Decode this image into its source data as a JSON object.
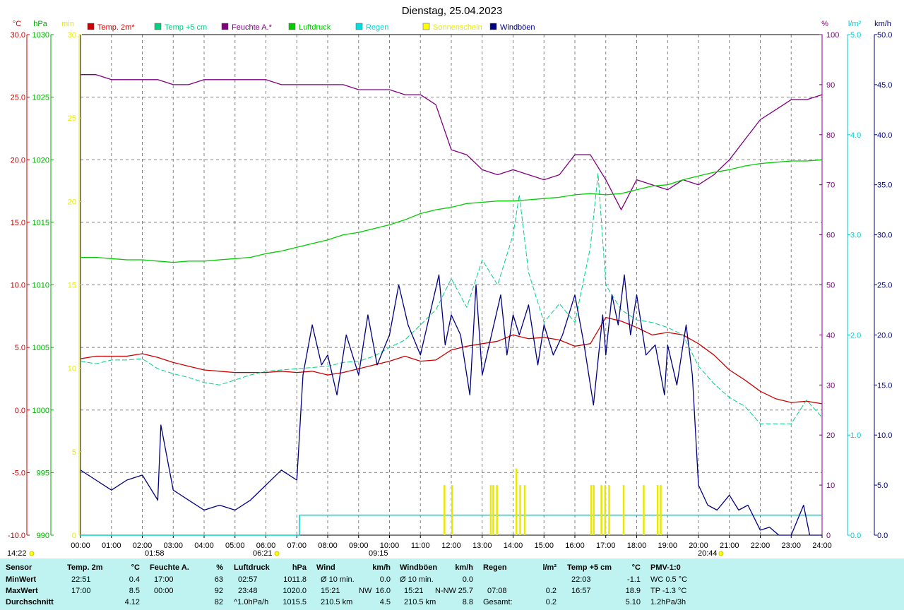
{
  "title": "Dienstag, 25.04.2023",
  "legend": [
    {
      "label": "Temp. 2m*",
      "color": "#cc0000"
    },
    {
      "label": "Temp +5 cm",
      "color": "#00d080"
    },
    {
      "label": "Feuchte A.*",
      "color": "#800080"
    },
    {
      "label": "Luftdruck",
      "color": "#00cc00"
    },
    {
      "label": "Regen",
      "color": "#00e0e0"
    },
    {
      "label": "Sonnenschein",
      "color": "#ffff00"
    },
    {
      "label": "Windböen",
      "color": "#000080"
    }
  ],
  "axis_units": {
    "temp": "°C",
    "pressure": "hPa",
    "sun": "min",
    "humidity": "%",
    "rain": "l/m²",
    "wind": "km/h"
  },
  "colors": {
    "temp": "#cc0000",
    "pressure": "#00aa00",
    "sun": "#e8e800",
    "humidity": "#800080",
    "rain": "#00d0d0",
    "wind": "#000080",
    "grid": "#808080",
    "summary_bg": "#bff3f1"
  },
  "sun_events": {
    "sunrise_label": "06:21",
    "sunset_label": "20:44",
    "moonrise_label": "01:58",
    "moonset_label": "09:15",
    "time_label": "14:22"
  },
  "chart_data": {
    "type": "line",
    "x_unit": "hour of day",
    "xlim": [
      0,
      24
    ],
    "x_ticks": [
      "00:00",
      "01:00",
      "02:00",
      "03:00",
      "04:00",
      "05:00",
      "06:00",
      "07:00",
      "08:00",
      "09:00",
      "10:00",
      "11:00",
      "12:00",
      "13:00",
      "14:00",
      "15:00",
      "16:00",
      "17:00",
      "18:00",
      "19:00",
      "20:00",
      "21:00",
      "22:00",
      "23:00",
      "24:00"
    ],
    "axes": {
      "temp": {
        "range": [
          -10,
          30
        ],
        "ticks": [
          "30.0",
          "25.0",
          "20.0",
          "15.0",
          "10.0",
          "5.0",
          "0.0",
          "-5.0",
          "-10.0"
        ]
      },
      "pressure": {
        "range": [
          990,
          1030
        ],
        "ticks": [
          "1030",
          "1025",
          "1020",
          "1015",
          "1010",
          "1005",
          "1000",
          "995",
          "990"
        ]
      },
      "sun": {
        "range": [
          0,
          30
        ],
        "ticks": [
          "30",
          "25",
          "20",
          "15",
          "10",
          "5",
          "0"
        ]
      },
      "humidity": {
        "range": [
          0,
          100
        ],
        "ticks": [
          "100",
          "90",
          "80",
          "70",
          "60",
          "50",
          "40",
          "30",
          "20",
          "10",
          "0"
        ]
      },
      "rain": {
        "range": [
          0,
          5
        ],
        "ticks": [
          "5.0",
          "4.0",
          "3.0",
          "2.0",
          "1.0",
          "0.0"
        ]
      },
      "wind": {
        "range": [
          0,
          50
        ],
        "ticks": [
          "50.0",
          "45.0",
          "40.0",
          "35.0",
          "30.0",
          "25.0",
          "20.0",
          "15.0",
          "10.0",
          "5.0",
          "0.0"
        ]
      }
    },
    "series": [
      {
        "name": "Temp. 2m*",
        "axis": "temp",
        "x": [
          0,
          0.5,
          1,
          1.5,
          2,
          2.5,
          3,
          3.5,
          4,
          4.5,
          5,
          5.5,
          6,
          6.5,
          7,
          7.5,
          8,
          8.5,
          9,
          9.5,
          10,
          10.5,
          11,
          11.5,
          12,
          12.5,
          13,
          13.5,
          14,
          14.5,
          15,
          15.5,
          16,
          16.5,
          17,
          17.5,
          18,
          18.5,
          19,
          19.5,
          20,
          20.5,
          21,
          21.5,
          22,
          22.5,
          23,
          23.5,
          24
        ],
        "y": [
          4.1,
          4.3,
          4.3,
          4.3,
          4.5,
          4.2,
          3.8,
          3.5,
          3.2,
          3.1,
          3.0,
          3.0,
          3.0,
          3.1,
          3.0,
          3.1,
          2.8,
          3.0,
          3.3,
          3.6,
          3.9,
          4.3,
          3.9,
          4.0,
          4.8,
          5.1,
          5.3,
          5.5,
          6.0,
          5.7,
          5.8,
          5.6,
          5.1,
          5.3,
          7.4,
          7.1,
          6.6,
          6.0,
          6.2,
          6.0,
          5.3,
          4.4,
          3.2,
          2.4,
          1.5,
          0.9,
          0.6,
          0.7,
          0.5
        ]
      },
      {
        "name": "Temp +5 cm",
        "axis": "temp",
        "x": [
          0,
          0.5,
          1,
          1.5,
          2,
          2.5,
          3,
          3.5,
          4,
          4.5,
          5,
          5.5,
          6,
          6.5,
          7,
          7.5,
          8,
          8.5,
          9,
          9.5,
          10,
          10.5,
          11,
          11.5,
          12,
          12.5,
          13,
          13.5,
          14,
          14.2,
          14.5,
          15,
          15.5,
          16,
          16.5,
          16.75,
          17,
          17.5,
          18,
          18.5,
          19,
          19.5,
          20,
          20.5,
          21,
          21.5,
          22,
          22.5,
          23,
          23.5,
          24
        ],
        "y": [
          3.9,
          3.7,
          4.0,
          4.0,
          4.1,
          3.3,
          2.9,
          2.6,
          2.2,
          2.0,
          2.4,
          2.8,
          3.1,
          3.2,
          3.3,
          3.4,
          3.5,
          3.8,
          3.9,
          4.3,
          5.0,
          5.6,
          6.8,
          8.0,
          10.5,
          8.2,
          12.0,
          10.0,
          14.0,
          17.2,
          11.0,
          7.0,
          8.5,
          7.0,
          13.0,
          18.9,
          10.0,
          8.0,
          7.2,
          7.0,
          6.6,
          6.0,
          3.5,
          2.1,
          1.0,
          0.3,
          -1.1,
          -1.1,
          -1.1,
          0.8,
          -0.6
        ]
      },
      {
        "name": "Feuchte A.*",
        "axis": "humidity",
        "x": [
          0,
          0.5,
          1,
          1.5,
          2,
          2.5,
          3,
          3.5,
          4,
          4.5,
          5,
          5.5,
          6,
          6.5,
          7,
          7.5,
          8,
          8.5,
          9,
          9.5,
          10,
          10.5,
          11,
          11.5,
          12,
          12.5,
          13,
          13.5,
          14,
          14.5,
          15,
          15.5,
          16,
          16.5,
          17,
          17.5,
          18,
          18.5,
          19,
          19.5,
          20,
          20.5,
          21,
          21.5,
          22,
          22.5,
          23,
          23.5,
          24
        ],
        "y": [
          92,
          92,
          91,
          91,
          91,
          91,
          90,
          90,
          91,
          91,
          91,
          91,
          91,
          90,
          90,
          90,
          90,
          90,
          89,
          89,
          89,
          88,
          88,
          86,
          77,
          76,
          73,
          72,
          73,
          72,
          71,
          72,
          76,
          76,
          71,
          65,
          71,
          70,
          69,
          71,
          70,
          72,
          75,
          79,
          83,
          85,
          87,
          87,
          88
        ]
      },
      {
        "name": "Luftdruck",
        "axis": "pressure",
        "x": [
          0,
          0.5,
          1,
          1.5,
          2,
          2.5,
          3,
          3.5,
          4,
          4.5,
          5,
          5.5,
          6,
          6.5,
          7,
          7.5,
          8,
          8.5,
          9,
          9.5,
          10,
          10.5,
          11,
          11.5,
          12,
          12.5,
          13,
          13.5,
          14,
          14.5,
          15,
          15.5,
          16,
          16.5,
          17,
          17.5,
          18,
          18.5,
          19,
          19.5,
          20,
          20.5,
          21,
          21.5,
          22,
          22.5,
          23,
          23.5,
          24
        ],
        "y": [
          1012.2,
          1012.2,
          1012.1,
          1012.0,
          1012.0,
          1011.9,
          1011.8,
          1011.9,
          1011.9,
          1012.0,
          1012.1,
          1012.2,
          1012.5,
          1012.7,
          1013.0,
          1013.3,
          1013.6,
          1014.0,
          1014.2,
          1014.5,
          1014.8,
          1015.2,
          1015.7,
          1016.0,
          1016.2,
          1016.5,
          1016.6,
          1016.7,
          1016.7,
          1016.8,
          1016.9,
          1017.0,
          1017.2,
          1017.3,
          1017.2,
          1017.3,
          1017.6,
          1017.9,
          1018.0,
          1018.4,
          1018.7,
          1019.0,
          1019.2,
          1019.5,
          1019.7,
          1019.8,
          1019.9,
          1019.9,
          1020.0
        ]
      },
      {
        "name": "Regen",
        "axis": "rain",
        "x": [
          0,
          7.08,
          7.09,
          24
        ],
        "y": [
          0,
          0,
          0.2,
          0.2
        ]
      },
      {
        "name": "Windböen",
        "axis": "wind",
        "x": [
          0,
          0.5,
          1,
          1.5,
          2,
          2.5,
          2.6,
          3,
          3.5,
          4,
          4.5,
          5,
          5.5,
          6,
          6.5,
          7,
          7.2,
          7.5,
          7.8,
          8,
          8.3,
          8.6,
          9,
          9.3,
          9.6,
          10,
          10.3,
          10.6,
          11,
          11.3,
          11.6,
          11.8,
          12,
          12.3,
          12.6,
          12.8,
          13,
          13.3,
          13.6,
          13.8,
          14,
          14.2,
          14.5,
          14.8,
          15,
          15.3,
          15.6,
          16,
          16.3,
          16.6,
          16.9,
          17,
          17.2,
          17.4,
          17.6,
          17.8,
          18,
          18.3,
          18.6,
          18.9,
          19,
          19.3,
          19.6,
          19.8,
          20,
          20.3,
          20.6,
          21,
          21.3,
          21.6,
          22,
          22.3,
          22.6,
          23,
          23.4,
          23.6,
          24
        ],
        "y": [
          6.5,
          5.5,
          4.5,
          5.5,
          6.0,
          3.5,
          11.0,
          4.5,
          3.5,
          2.5,
          3.0,
          2.5,
          3.5,
          5.0,
          6.5,
          5.5,
          16.0,
          21.0,
          17.0,
          18.0,
          14.0,
          20.0,
          16.0,
          22.0,
          17.0,
          20.0,
          25.0,
          21.0,
          18.0,
          22.0,
          26.0,
          19.0,
          22.0,
          20.0,
          14.0,
          25.0,
          16.0,
          20.0,
          24.0,
          18.0,
          22.0,
          20.0,
          23.0,
          17.0,
          21.0,
          18.0,
          20.0,
          24.0,
          19.0,
          13.0,
          22.0,
          18.0,
          24.0,
          21.0,
          26.0,
          20.0,
          24.0,
          18.0,
          19.0,
          14.0,
          19.0,
          15.0,
          21.0,
          16.0,
          5.0,
          3.0,
          2.5,
          4.0,
          2.5,
          3.0,
          0.5,
          0.8,
          0,
          0,
          3.0,
          0,
          0
        ]
      },
      {
        "name": "Sonnenschein",
        "axis": "sun",
        "type": "bar",
        "x": [
          11.75,
          12.0,
          13.25,
          13.33,
          13.45,
          14.08,
          14.2,
          14.35,
          16.5,
          16.58,
          16.83,
          16.95,
          17.08,
          17.55,
          18.2,
          18.65,
          18.75
        ],
        "y": [
          3.0,
          3.0,
          3.0,
          3.0,
          3.0,
          4.0,
          3.0,
          3.0,
          3.0,
          3.0,
          3.0,
          3.0,
          3.0,
          3.0,
          3.0,
          3.0,
          3.0
        ]
      }
    ]
  },
  "summary": {
    "headers": {
      "sensor": "Sensor",
      "temp": "Temp. 2m",
      "temp_unit": "°C",
      "hum": "Feuchte A.",
      "hum_unit": "%",
      "press": "Luftdruck",
      "press_unit": "hPa",
      "wind": "Wind",
      "wind_unit": "km/h",
      "gust": "Windböen",
      "gust_unit": "km/h",
      "rain": "Regen",
      "rain_unit": "l/m²",
      "temp5": "Temp +5 cm",
      "temp5_unit": "°C",
      "pmv": "PMV-1:0"
    },
    "rows": [
      {
        "label": "MinWert",
        "temp_t": "22:51",
        "temp_v": "0.4",
        "hum_t": "17:00",
        "hum_v": "63",
        "press_t": "02:57",
        "press_v": "1011.8",
        "wind_t": "Ø 10 min.",
        "wind_v": "0.0",
        "gust_t": "Ø 10 min.",
        "gust_v": "0.0",
        "rain_t": "",
        "rain_v": "",
        "temp5_t": "22:03",
        "temp5_v": "-1.1",
        "pmv": "WC 0.5 °C"
      },
      {
        "label": "MaxWert",
        "temp_t": "17:00",
        "temp_v": "8.5",
        "hum_t": "00:00",
        "hum_v": "92",
        "press_t": "23:48",
        "press_v": "1020.0",
        "wind_t": "15:21",
        "wind_dir": "NW",
        "wind_v": "16.0",
        "gust_t": "15:21",
        "gust_dir": "N-NW",
        "gust_v": "25.7",
        "rain_t": "07:08",
        "rain_v": "0.2",
        "temp5_t": "16:57",
        "temp5_v": "18.9",
        "pmv": "TP -1.3 °C"
      },
      {
        "label": "Durchschnitt",
        "temp_t": "",
        "temp_v": "4.12",
        "hum_t": "",
        "hum_v": "82",
        "press_t": "^1.0hPa/h",
        "press_v": "1015.5",
        "wind_t": "210.5 km",
        "wind_v": "4.5",
        "gust_t": "210.5 km",
        "gust_v": "8.8",
        "rain_t": "Gesamt:",
        "rain_v": "0.2",
        "temp5_t": "",
        "temp5_v": "5.10",
        "pmv": "1.2hPa/3h"
      }
    ]
  }
}
